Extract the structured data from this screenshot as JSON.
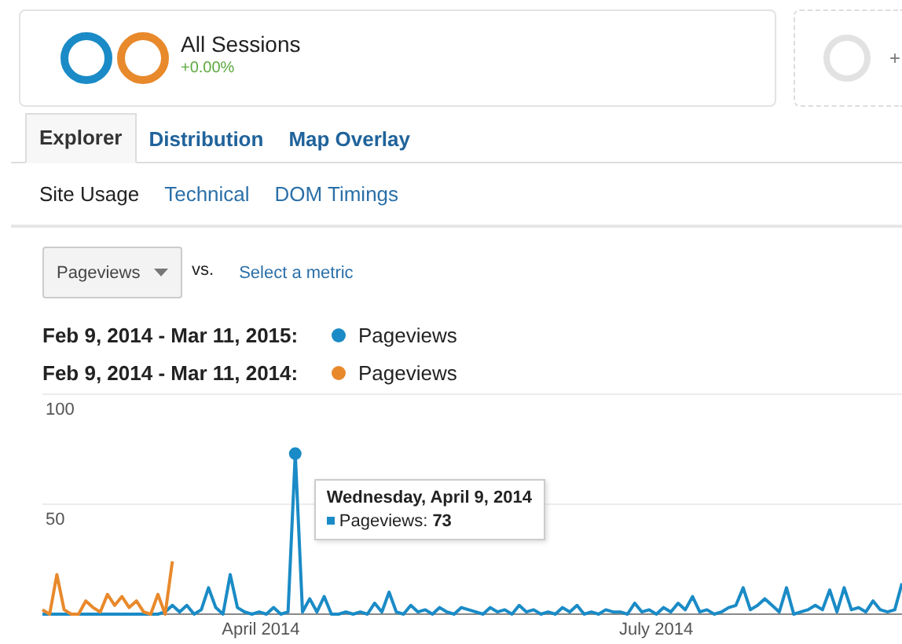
{
  "segment": {
    "title": "All Sessions",
    "change": "+0.00%",
    "rings": [
      {
        "color": "#1a8bc6"
      },
      {
        "color": "#e8892b"
      }
    ]
  },
  "add_segment": {
    "label": "+"
  },
  "tabs": [
    {
      "label": "Explorer",
      "selected": true
    },
    {
      "label": "Distribution",
      "selected": false
    },
    {
      "label": "Map Overlay",
      "selected": false
    }
  ],
  "subtabs": [
    {
      "label": "Site Usage",
      "selected": true
    },
    {
      "label": "Technical",
      "selected": false
    },
    {
      "label": "DOM Timings",
      "selected": false
    }
  ],
  "metric": {
    "value": "Pageviews",
    "vs": "vs.",
    "select_link": "Select a metric"
  },
  "legend": [
    {
      "range": "Feb 9, 2014 - Mar 11, 2015:",
      "metric": "Pageviews",
      "color": "#1a8bc6"
    },
    {
      "range": "Feb 9, 2014 - Mar 11, 2014:",
      "metric": "Pageviews",
      "color": "#e8892b"
    }
  ],
  "chart": {
    "chart_data": {
      "type": "line",
      "ylim": [
        0,
        100
      ],
      "yticks": [
        50,
        100
      ],
      "series": [
        {
          "color": "#1a8bc6",
          "values": [
            0,
            0,
            0,
            0,
            0,
            0,
            0,
            0,
            0,
            0,
            0,
            0,
            0,
            0,
            0,
            0,
            0,
            1,
            4,
            1,
            4,
            0,
            2,
            12,
            3,
            0,
            18,
            3,
            1,
            0,
            1,
            0,
            3,
            0,
            1,
            73,
            1,
            7,
            1,
            8,
            0,
            0,
            1,
            0,
            1,
            0,
            5,
            1,
            10,
            1,
            0,
            4,
            1,
            2,
            0,
            3,
            1,
            0,
            3,
            2,
            1,
            0,
            3,
            1,
            2,
            0,
            4,
            1,
            2,
            0,
            1,
            0,
            3,
            1,
            4,
            0,
            1,
            0,
            2,
            1,
            1,
            0,
            5,
            1,
            2,
            0,
            3,
            1,
            5,
            2,
            8,
            1,
            2,
            0,
            1,
            3,
            4,
            12,
            2,
            4,
            7,
            4,
            1,
            12,
            0,
            1,
            2,
            4,
            2,
            11,
            1,
            12,
            2,
            3,
            1,
            6,
            2,
            1,
            2,
            14
          ]
        },
        {
          "color": "#e8892b",
          "values": [
            2,
            0,
            18,
            2,
            0,
            0,
            6,
            3,
            1,
            9,
            4,
            8,
            3,
            6,
            1,
            0,
            9,
            0,
            24,
            null,
            null,
            null,
            null,
            null,
            null,
            null,
            null,
            null,
            null,
            null,
            null,
            null,
            null,
            null,
            null,
            null,
            null,
            null,
            null,
            null,
            null,
            null,
            null,
            null,
            null,
            null,
            null,
            null,
            null,
            null,
            null,
            null,
            null,
            null,
            null,
            null,
            null,
            null,
            null,
            null,
            null,
            null,
            null,
            null,
            null,
            null,
            null,
            null,
            null,
            null,
            null,
            null,
            null,
            null,
            null,
            null,
            null,
            null,
            null,
            null,
            null,
            null,
            null,
            null,
            null,
            null,
            null,
            null,
            null,
            null,
            null,
            null,
            null,
            null,
            null,
            null,
            null,
            null,
            null,
            null,
            null,
            null,
            null,
            null,
            null,
            null,
            null,
            null,
            null,
            null,
            null,
            null,
            null,
            null,
            null,
            null,
            null,
            null,
            null,
            null
          ]
        }
      ]
    },
    "x_labels": [
      "April 2014",
      "July 2014"
    ],
    "tooltip": {
      "title": "Wednesday, April 9, 2014",
      "text": "Pageviews: **73**"
    }
  }
}
